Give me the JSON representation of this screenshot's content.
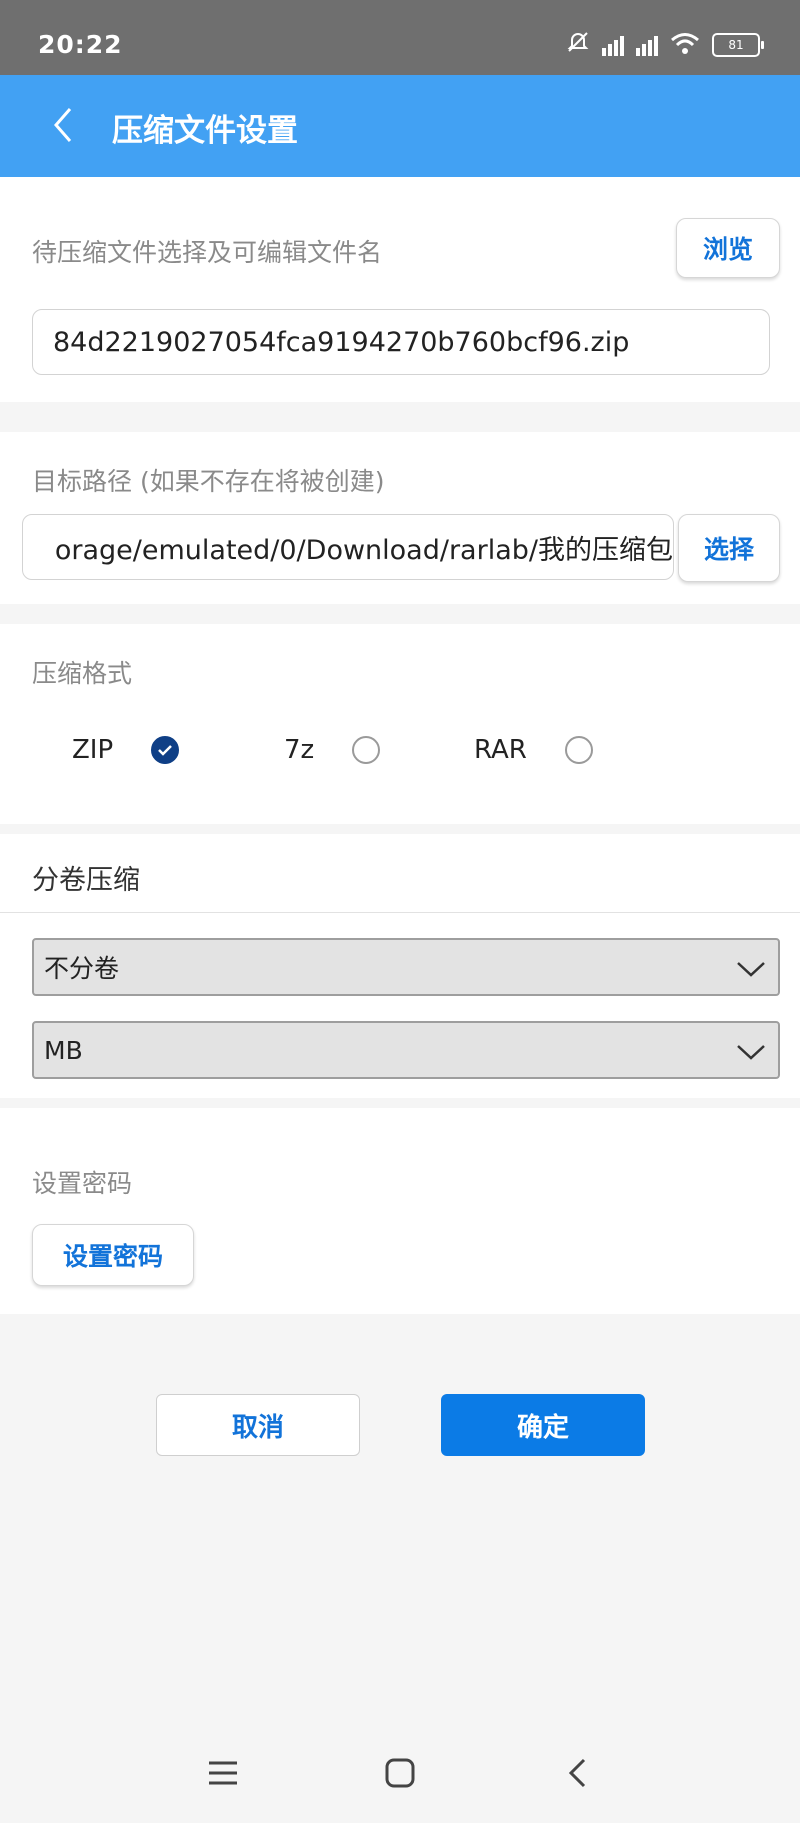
{
  "status_bar": {
    "time": "20:22",
    "battery": "81"
  },
  "app_bar": {
    "title": "压缩文件设置"
  },
  "file_section": {
    "label": "待压缩文件选择及可编辑文件名",
    "browse_label": "浏览",
    "filename": "84d2219027054fca9194270b760bcf96.zip"
  },
  "path_section": {
    "label": "目标路径 (如果不存在将被创建)",
    "path_value": "orage/emulated/0/Download/rarlab/我的压缩包",
    "select_label": "选择"
  },
  "format_section": {
    "label": "压缩格式",
    "options": [
      {
        "label": "ZIP",
        "checked": true
      },
      {
        "label": "7z",
        "checked": false
      },
      {
        "label": "RAR",
        "checked": false
      }
    ]
  },
  "split_section": {
    "label": "分卷压缩",
    "split_mode": "不分卷",
    "unit": "MB"
  },
  "password_section": {
    "label": "设置密码",
    "button_label": "设置密码"
  },
  "actions": {
    "cancel_label": "取消",
    "ok_label": "确定"
  },
  "nav": {
    "icons": [
      "menu-icon",
      "home-icon",
      "back-icon"
    ]
  },
  "colors": {
    "app_bar": "#42a1f3",
    "accent": "#0b7be6",
    "link": "#1273d9",
    "radio_checked": "#0f3f86"
  }
}
